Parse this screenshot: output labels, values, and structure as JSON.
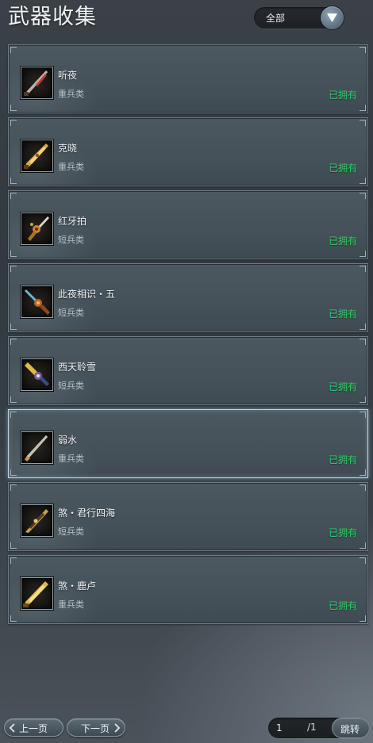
{
  "header": {
    "title": "武器收集",
    "filter": {
      "selected": "全部"
    }
  },
  "weapons": [
    {
      "name": "听夜",
      "type": "重兵类",
      "status": "已拥有",
      "icon": "blade-icon"
    },
    {
      "name": "克晓",
      "type": "重兵类",
      "status": "已拥有",
      "icon": "gold-blade-icon"
    },
    {
      "name": "红牙拍",
      "type": "短兵类",
      "status": "已拥有",
      "icon": "short-blade-icon"
    },
    {
      "name": "此夜相识・五",
      "type": "短兵类",
      "status": "已拥有",
      "icon": "short-blade-icon"
    },
    {
      "name": "西天聆雪",
      "type": "短兵类",
      "status": "已拥有",
      "icon": "short-blade-icon"
    },
    {
      "name": "弱水",
      "type": "重兵类",
      "status": "已拥有",
      "icon": "blade-icon"
    },
    {
      "name": "煞・君行四海",
      "type": "短兵类",
      "status": "已拥有",
      "icon": "short-blade-icon"
    },
    {
      "name": "煞・鹿卢",
      "type": "重兵类",
      "status": "已拥有",
      "icon": "gold-blade-icon"
    }
  ],
  "pagination": {
    "prev_label": "上一页",
    "next_label": "下一页",
    "current_page": "1",
    "total": "/1",
    "goto_label": "跳转"
  },
  "colors": {
    "owned_status": "#2fd36a",
    "selected_border": "#b9d4e2"
  }
}
